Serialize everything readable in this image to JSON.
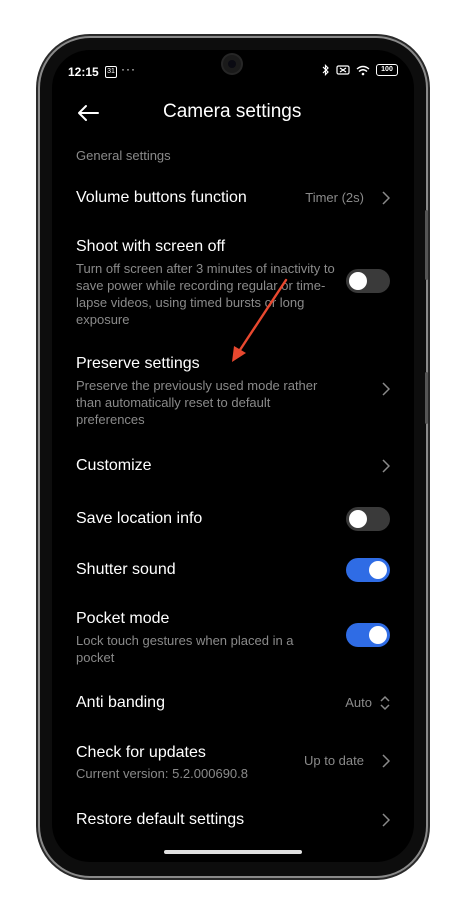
{
  "status": {
    "time": "12:15",
    "calendar": "31",
    "more": "···",
    "battery": "100",
    "icons": [
      "bluetooth-icon",
      "mute-icon",
      "wifi-icon",
      "battery-icon"
    ]
  },
  "header": {
    "title": "Camera settings",
    "back_icon": "back-arrow-icon"
  },
  "section_label": "General settings",
  "items": [
    {
      "title": "Volume buttons function",
      "value": "Timer (2s)"
    },
    {
      "title": "Shoot with screen off",
      "desc": "Turn off screen after 3 minutes of inactivity to save power while recording regular or time-lapse videos, using timed bursts or long exposure",
      "toggle": false
    },
    {
      "title": "Preserve settings",
      "desc": "Preserve the previously used mode rather than automatically reset to default preferences"
    },
    {
      "title": "Customize"
    },
    {
      "title": "Save location info",
      "toggle": false
    },
    {
      "title": "Shutter sound",
      "toggle": true
    },
    {
      "title": "Pocket mode",
      "desc": "Lock touch gestures when placed in a pocket",
      "toggle": true
    },
    {
      "title": "Anti banding",
      "value": "Auto"
    },
    {
      "title": "Check for updates",
      "desc": "Current version: 5.2.000690.8",
      "value": "Up to date"
    },
    {
      "title": "Restore default settings"
    }
  ],
  "colors": {
    "accent": "#2f6ce5",
    "annotation_arrow": "#e8482f",
    "secondary_text": "#8a8a8a"
  }
}
